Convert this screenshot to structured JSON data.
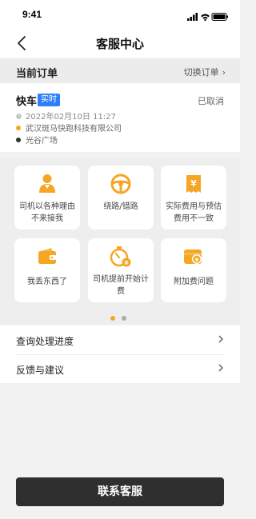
{
  "status_bar": {
    "time": "9:41"
  },
  "nav": {
    "title": "客服中心"
  },
  "order_section": {
    "title": "当前订单",
    "switch_label": "切换订单"
  },
  "order": {
    "car_type": "快车",
    "badge": "实时",
    "status": "已取消",
    "time": "2022年02月10日 11:27",
    "from": "武汉斑马快跑科技有限公司",
    "to": "光谷广场",
    "from_dot_color": "#f5a623",
    "to_dot_color": "#333333"
  },
  "issues": [
    {
      "label": "司机以各种理由不来接我",
      "icon": "driver-icon"
    },
    {
      "label": "绕路/错路",
      "icon": "steering-wheel-icon"
    },
    {
      "label": "实际费用与预估费用不一致",
      "icon": "yuan-receipt-icon"
    },
    {
      "label": "我丢东西了",
      "icon": "wallet-icon"
    },
    {
      "label": "司机提前开始计费",
      "icon": "stopwatch-icon"
    },
    {
      "label": "附加费问题",
      "icon": "fee-card-icon"
    }
  ],
  "pager": {
    "active_color": "#f5a623",
    "inactive_color": "#aaaaaa"
  },
  "menu": [
    {
      "label": "查询处理进度"
    },
    {
      "label": "反馈与建议"
    }
  ],
  "contact_button": {
    "label": "联系客服"
  },
  "colors": {
    "accent": "#f5a623",
    "badge": "#2d7ff9",
    "button": "#2f2f2f"
  }
}
